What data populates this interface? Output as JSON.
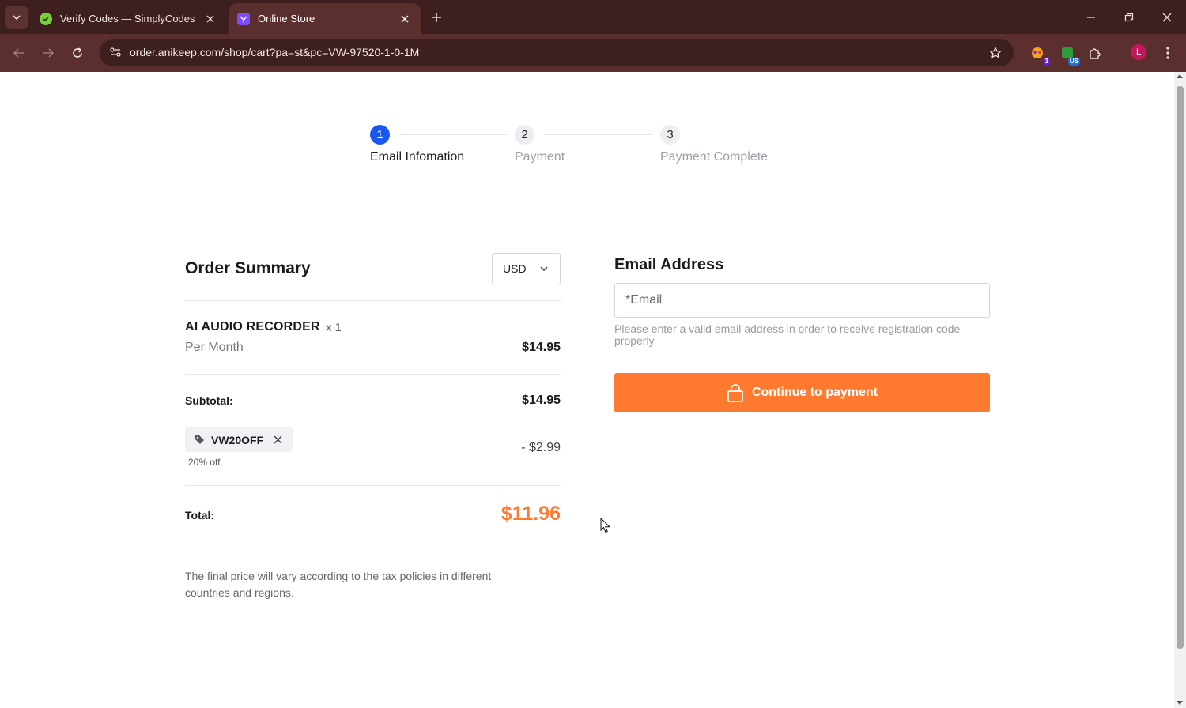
{
  "browser": {
    "tabs": [
      {
        "title": "Verify Codes — SimplyCodes",
        "active": false,
        "favicon": "simplycodes-icon"
      },
      {
        "title": "Online Store",
        "active": true,
        "favicon": "store-icon"
      }
    ],
    "url": "order.anikeep.com/shop/cart?pa=st&pc=VW-97520-1-0-1M",
    "extensions": [
      {
        "name": "extension-badge-icon",
        "badge": "3"
      },
      {
        "name": "extension-vpn-icon",
        "badge": "US"
      }
    ],
    "profile_initial": "L"
  },
  "stepper": {
    "steps": [
      {
        "number": "1",
        "label": "Email Infomation",
        "state": "active"
      },
      {
        "number": "2",
        "label": "Payment",
        "state": "pending"
      },
      {
        "number": "3",
        "label": "Payment Complete",
        "state": "pending"
      }
    ]
  },
  "order_summary": {
    "title": "Order Summary",
    "currency": "USD",
    "product": {
      "name": "AI AUDIO RECORDER",
      "quantity": "x 1",
      "period": "Per Month",
      "price": "$14.95"
    },
    "subtotal_label": "Subtotal:",
    "subtotal_value": "$14.95",
    "coupon": {
      "code": "VW20OFF",
      "description": "20% off",
      "discount": "- $2.99"
    },
    "total_label": "Total:",
    "total_value": "$11.96",
    "note": "The final price will vary according to the tax policies in different countries and regions."
  },
  "email_section": {
    "title": "Email Address",
    "placeholder": "*Email",
    "value": "",
    "hint": "Please enter a valid email address in order to receive registration code properly.",
    "button_label": "Continue to payment"
  },
  "colors": {
    "accent_orange": "#ff7a2e",
    "step_active": "#1a56f0",
    "chrome_bg": "#3c1f1e",
    "toolbar_bg": "#5b2f2d"
  }
}
